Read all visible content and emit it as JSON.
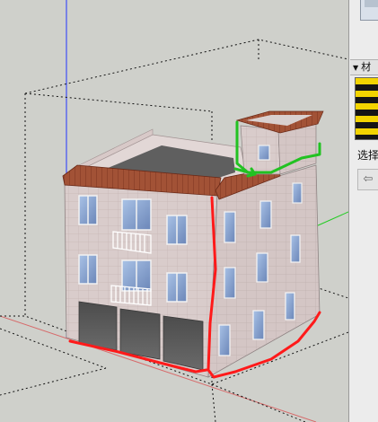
{
  "panel": {
    "section_title": "材",
    "select_label": "选择",
    "icons": {
      "collapse": "triangle-down-icon",
      "back": "arrow-left-icon"
    }
  },
  "colors": {
    "viewport_background": "#cfd0cb",
    "wall": "#d7c9c9",
    "roof_tile": "#9b4a2f",
    "annotation_red": "#ff1a1a",
    "annotation_green": "#22c222",
    "axis_blue": "#2233ff",
    "axis_green": "#22cc22"
  }
}
